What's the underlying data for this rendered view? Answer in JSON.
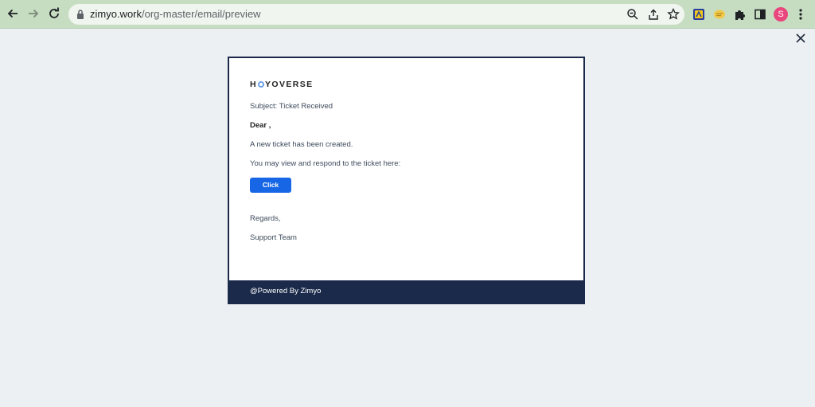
{
  "browser": {
    "url_host": "zimyo.work",
    "url_path": "/org-master/email/preview",
    "profile_initial": "S",
    "icons": [
      "back-arrow-icon",
      "forward-arrow-icon",
      "reload-icon",
      "lock-icon",
      "zoom-icon",
      "share-icon",
      "bookmark-star-icon",
      "extension-icon",
      "puzzle-icon",
      "side-panel-icon",
      "kebab-menu-icon"
    ]
  },
  "preview": {
    "close_icon": "close-icon"
  },
  "email": {
    "logo_prefix": "H",
    "logo_suffix": "YOVERSE",
    "subject": "Subject: Ticket Received",
    "greeting": "Dear ,",
    "line1": "A new ticket has been created.",
    "line2": "You may view and respond to the ticket here:",
    "button_label": "Click",
    "regards": "Regards,",
    "signature": "Support Team",
    "footer": "@Powered By Zimyo"
  },
  "colors": {
    "chrome": "#c6ddc2",
    "page_bg": "#edf0f2",
    "footer_bg": "#1b2a4a",
    "button": "#1766e6",
    "avatar": "#e8467c"
  }
}
